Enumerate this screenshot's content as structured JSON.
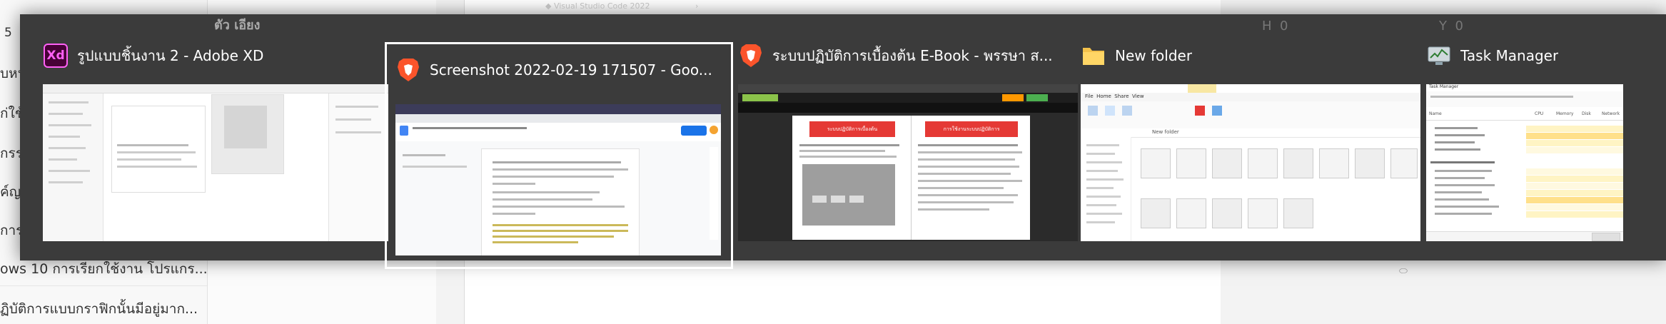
{
  "background": {
    "left_items": [
      "5",
      "บหน้าต่างป",
      "ก่ใช้งานโป",
      "กรระบบปฏ",
      "ค์ญ",
      "การเปิดโป",
      "ows 10 การเรียกใช้งาน โปรแกร...",
      "ฏิบัติการแบบกราฟิกนั้นมีอยู่มาก..."
    ],
    "top_label": "ตัว เอียง",
    "menu_item": "Visual Studio Code 2022",
    "h_label": "H",
    "h_value": "0",
    "y_label": "Y",
    "y_value": "0"
  },
  "switcher": {
    "windows": [
      {
        "id": "xd",
        "title": "รูปแบบชิ้นงาน 2 - Adobe XD",
        "icon": "adobe-xd-icon",
        "icon_text": "Xd",
        "selected": false
      },
      {
        "id": "brave1",
        "title": "Screenshot 2022-02-19 171507 - Goo...",
        "icon": "brave-browser-icon",
        "selected": true
      },
      {
        "id": "brave2",
        "title": "ระบบปฏิบัติการเบื้องต้น E-Book - พรรษา ส...",
        "icon": "brave-browser-icon",
        "selected": false
      },
      {
        "id": "folder",
        "title": "New folder",
        "icon": "folder-icon",
        "selected": false
      },
      {
        "id": "taskmgr",
        "title": "Task Manager",
        "icon": "task-manager-icon",
        "selected": false
      }
    ],
    "thumb_text": {
      "docs_heading": "Screenshot 2022-02-19 171507",
      "ebook_banner_left": "ระบบปฏิบัติการเบื้องต้น",
      "ebook_banner_right": "การใช้งานระบบปฏิบัติการ",
      "folder_tabs": [
        "File",
        "Home",
        "Share",
        "View"
      ],
      "folder_breadcrumb": "New folder",
      "task_title": "Task Manager",
      "task_header": [
        "Name",
        "CPU",
        "Memory",
        "Disk",
        "Network"
      ]
    }
  }
}
